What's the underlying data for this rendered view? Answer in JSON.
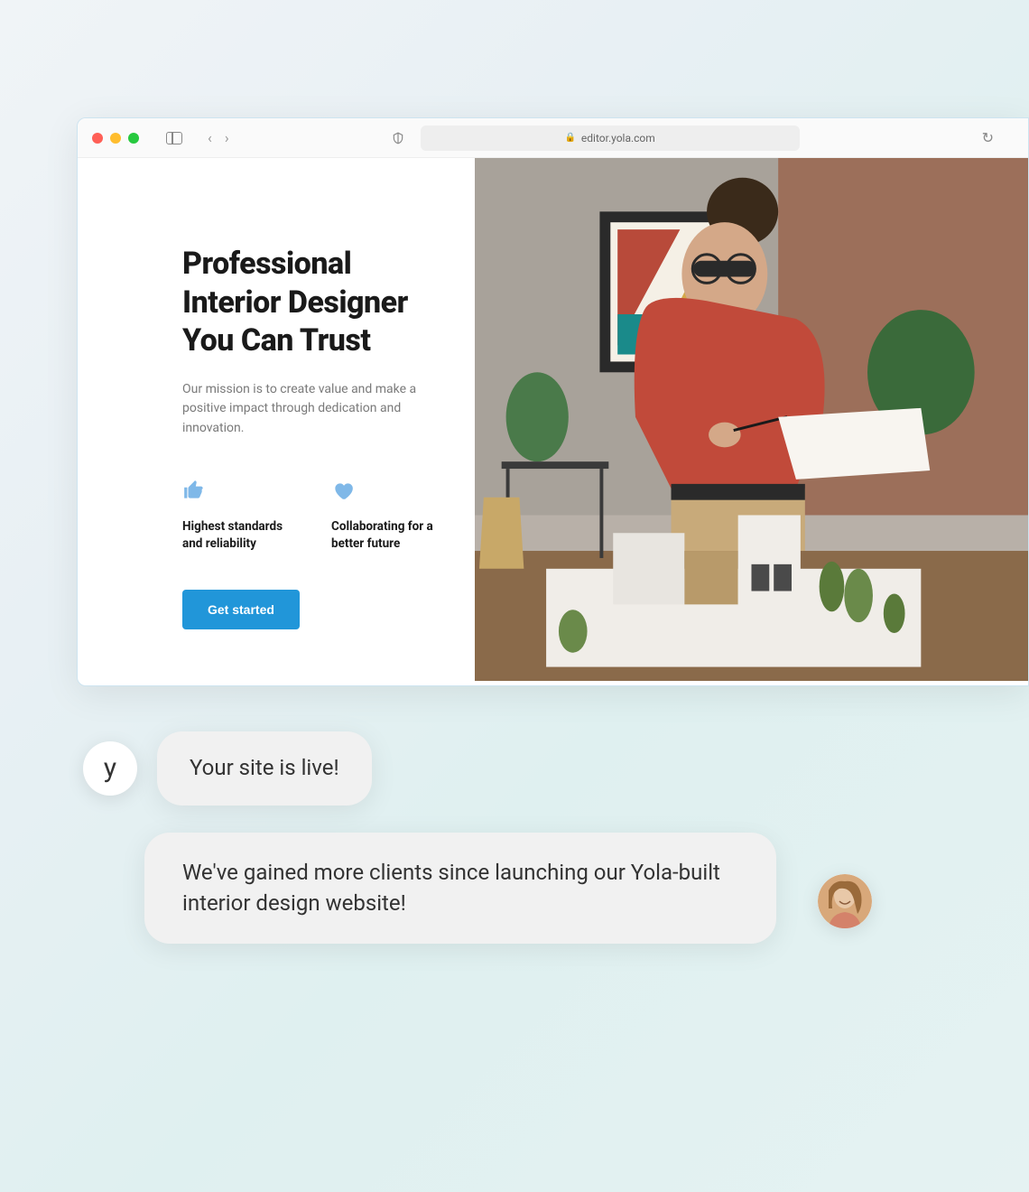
{
  "browser": {
    "url": "editor.yola.com"
  },
  "hero": {
    "title": "Professional Interior Designer You Can Trust",
    "subtitle": "Our mission is to create value and make a positive impact through dedication and innovation.",
    "features": [
      {
        "icon": "thumbs-up",
        "text": "Highest standards and reliability"
      },
      {
        "icon": "heart",
        "text": "Collaborating for a better future"
      }
    ],
    "cta": "Get started"
  },
  "chat": {
    "avatar_logo": "y",
    "message1": "Your site is live!",
    "message2": "We've gained more clients since launching our Yola-built interior design website!"
  }
}
